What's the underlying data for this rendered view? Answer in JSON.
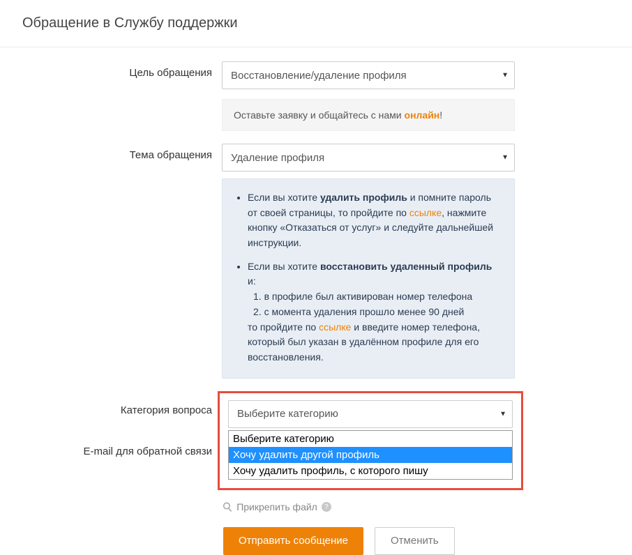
{
  "title": "Обращение в Службу поддержки",
  "purpose": {
    "label": "Цель обращения",
    "value": "Восстановление/удаление профиля",
    "notice_prefix": "Оставьте заявку и общайтесь с нами ",
    "notice_accent": "онлайн",
    "notice_suffix": "!"
  },
  "topic": {
    "label": "Тема обращения",
    "value": "Удаление профиля"
  },
  "info": {
    "b1_prefix": "Если вы хотите ",
    "b1_bold": "удалить профиль",
    "b1_mid": " и помните пароль от своей страницы, то пройдите по ",
    "b1_link": "ссылке",
    "b1_tail": ", нажмите кнопку «Отказаться от услуг» и следуйте дальнейшей инструкции.",
    "b2_prefix": "Если вы хотите ",
    "b2_bold": "восстановить удаленный профиль",
    "b2_mid": " и:",
    "b2_line1": " 1. в профиле был активирован номер телефона",
    "b2_line2": " 2. с момента удаления прошло менее 90 дней",
    "b2_tail_pre": "то пройдите по ",
    "b2_tail_link": "ссылке",
    "b2_tail_post": " и введите номер телефона, который был указан в удалённом профиле для его восстановления."
  },
  "category": {
    "label": "Категория вопроса",
    "selected": "Выберите категорию",
    "options": {
      "o0": "Выберите категорию",
      "o1": "Хочу удалить другой профиль",
      "o2": "Хочу удалить профиль, с которого пишу"
    }
  },
  "email": {
    "label": "E-mail для обратной связи"
  },
  "attach": {
    "label": "Прикрепить файл"
  },
  "buttons": {
    "submit": "Отправить сообщение",
    "cancel": "Отменить"
  }
}
